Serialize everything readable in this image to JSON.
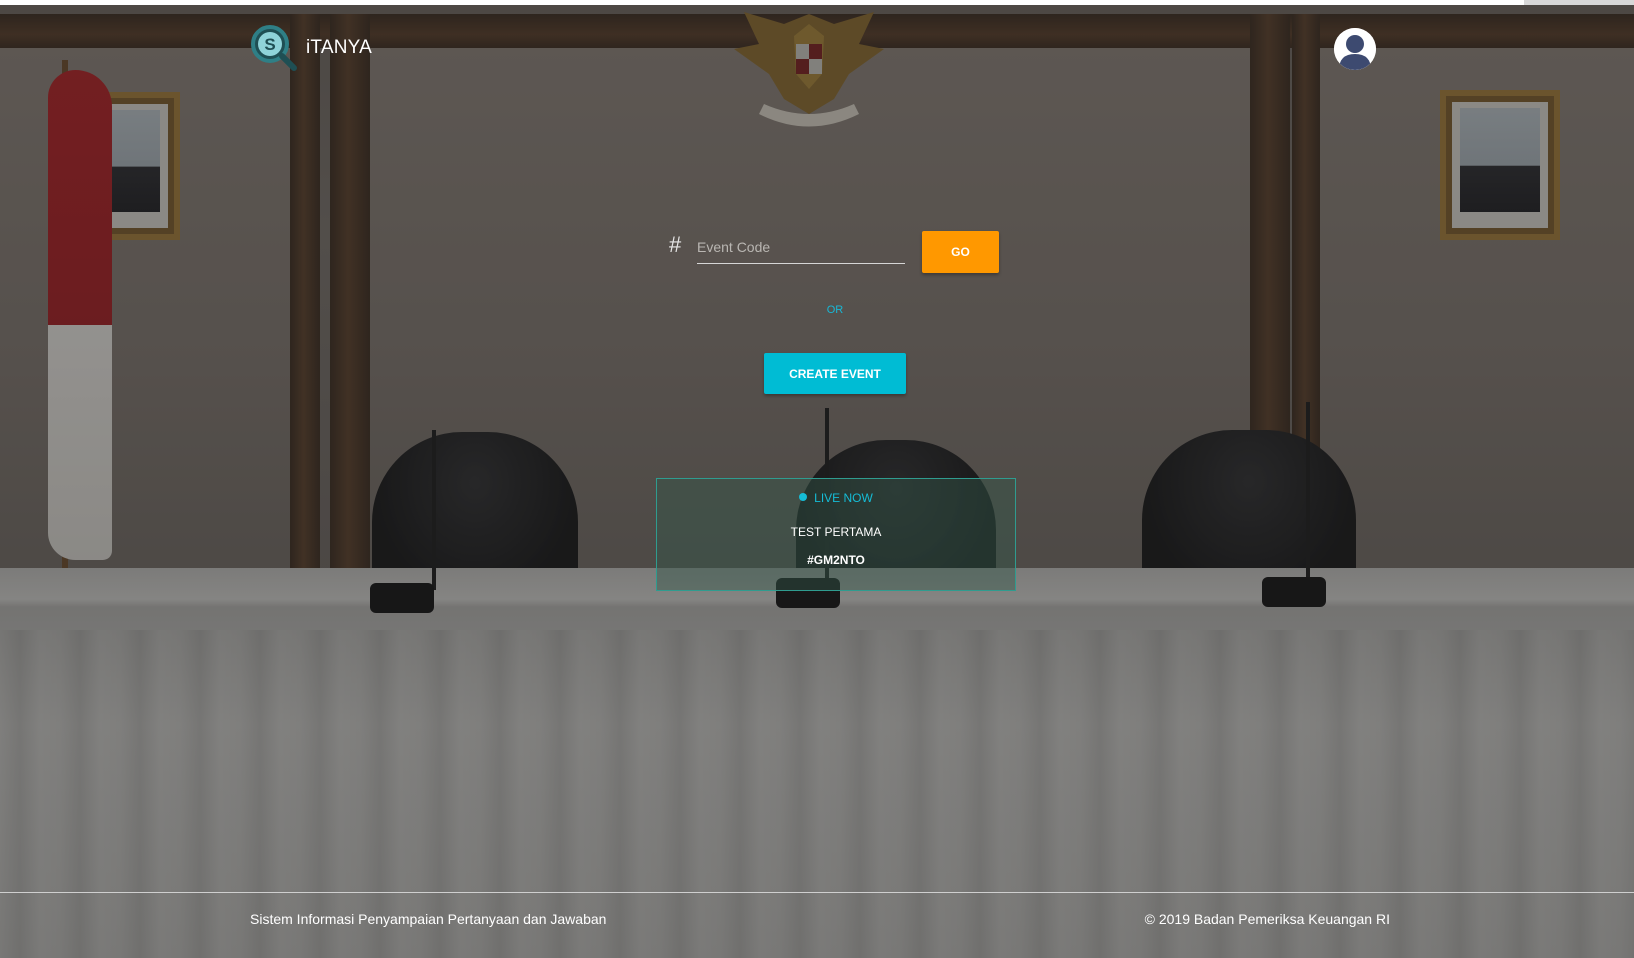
{
  "header": {
    "brand_name": "iTANYA",
    "logo_letter": "S",
    "avatar_icon": "user-avatar-icon"
  },
  "form": {
    "hash_symbol": "#",
    "event_code_placeholder": "Event Code",
    "event_code_value": "",
    "go_label": "GO",
    "or_label": "OR",
    "create_label": "CREATE EVENT"
  },
  "live_event": {
    "status_label": "LIVE NOW",
    "title": "TEST PERTAMA",
    "code": "#GM2NTO"
  },
  "footer": {
    "left_text": "Sistem Informasi Penyampaian Pertanyaan dan Jawaban",
    "right_text": "© 2019 Badan Pemeriksa Keuangan RI"
  },
  "colors": {
    "go_button": "#ff9800",
    "create_button": "#00bcd4",
    "accent_cyan": "#15bcd6",
    "card_border": "#2f9c8f"
  }
}
